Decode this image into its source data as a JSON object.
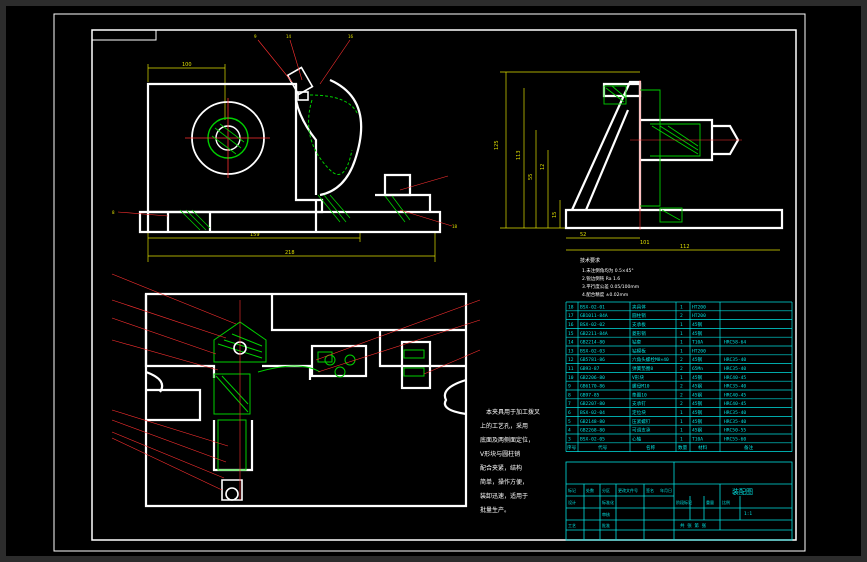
{
  "drawing": {
    "title_block_name": "装配图",
    "scale_text": "1:1",
    "sheet_text": "共 张 第 张"
  },
  "dimensions": {
    "front": [
      "100",
      "159",
      "218",
      "9",
      "14",
      "16",
      "8",
      "18"
    ],
    "side": [
      "125",
      "113",
      "55",
      "12",
      "15",
      "52",
      "101",
      "112"
    ]
  },
  "tech_requirements": {
    "heading": "技术要求",
    "lines": [
      "1.未注倒角均为 0.5×45°",
      "2.锐边倒钝 Ra 1.6",
      "3.平行度公差 0.05/100mm",
      "4.配合精度 ±0.02mm"
    ]
  },
  "description": [
    "本夹具用于加工拨叉",
    "上的工艺孔，采用",
    "底面及两侧面定位，",
    "V形块与圆柱销",
    "配合夹紧，结构",
    "简单，操作方便，",
    "装卸迅速，适用于",
    "批量生产。"
  ],
  "bom": [
    {
      "no": "18",
      "code": "BSX-02-01",
      "name": "夹具体",
      "qty": "1",
      "mat": "HT200",
      "note": ""
    },
    {
      "no": "17",
      "code": "GB1011-84A",
      "name": "圆柱销",
      "qty": "2",
      "mat": "HT200",
      "note": ""
    },
    {
      "no": "16",
      "code": "BSX-02-02",
      "name": "支承板",
      "qty": "1",
      "mat": "45钢",
      "note": ""
    },
    {
      "no": "15",
      "code": "GB2211-84A",
      "name": "菱形销",
      "qty": "1",
      "mat": "45钢",
      "note": ""
    },
    {
      "no": "14",
      "code": "GB2214-80",
      "name": "钻套",
      "qty": "1",
      "mat": "T10A",
      "note": "HRC58-64"
    },
    {
      "no": "13",
      "code": "BSX-02-03",
      "name": "钻模板",
      "qty": "1",
      "mat": "HT200",
      "note": ""
    },
    {
      "no": "12",
      "code": "GB5781-86",
      "name": "六角头螺栓M8×40",
      "qty": "2",
      "mat": "45钢",
      "note": "HRC35-40"
    },
    {
      "no": "11",
      "code": "GB93-87",
      "name": "弹簧垫圈8",
      "qty": "2",
      "mat": "65Mn",
      "note": "HRC35-40"
    },
    {
      "no": "10",
      "code": "GB2206-80",
      "name": "V形块",
      "qty": "1",
      "mat": "45钢",
      "note": "HRC40-45"
    },
    {
      "no": "9",
      "code": "GB6170-86",
      "name": "螺母M10",
      "qty": "2",
      "mat": "45钢",
      "note": "HRC35-40"
    },
    {
      "no": "8",
      "code": "GB97-85",
      "name": "垫圈10",
      "qty": "2",
      "mat": "45钢",
      "note": "HRC40-45"
    },
    {
      "no": "7",
      "code": "GB2207-80",
      "name": "支承钉",
      "qty": "2",
      "mat": "45钢",
      "note": "HRC40-45"
    },
    {
      "no": "6",
      "code": "BSX-02-04",
      "name": "定位块",
      "qty": "1",
      "mat": "45钢",
      "note": "HRC35-40"
    },
    {
      "no": "5",
      "code": "GB2148-80",
      "name": "压紧螺钉",
      "qty": "1",
      "mat": "45钢",
      "note": "HRC35-40"
    },
    {
      "no": "4",
      "code": "GB2268-80",
      "name": "可调支承",
      "qty": "1",
      "mat": "45钢",
      "note": "HRC50-55"
    },
    {
      "no": "3",
      "code": "BSX-02-05",
      "name": "心轴",
      "qty": "1",
      "mat": "T10A",
      "note": "HRC55-60"
    }
  ],
  "bom_header": {
    "no": "序号",
    "code": "代号",
    "name": "名称",
    "qty": "数量",
    "mat": "材料",
    "note": "备注"
  },
  "title_block_labels": [
    "标记",
    "处数",
    "分区",
    "更改文件号",
    "签名",
    "年月日",
    "设计",
    "标准化",
    "审核",
    "工艺",
    "批准",
    "阶段标记",
    "重量",
    "比例"
  ],
  "colors": {
    "background": "#000000",
    "border": "#ffffff",
    "table": "#00e0e0",
    "hidden": "#00d000",
    "dim": "#e0e000",
    "leader": "#ff3030"
  }
}
